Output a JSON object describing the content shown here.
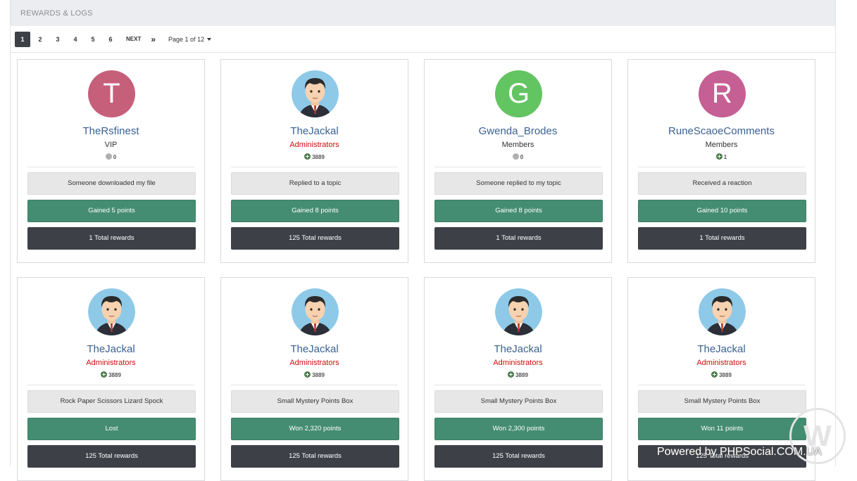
{
  "header": {
    "title": "REWARDS & LOGS"
  },
  "pagination": {
    "pages": [
      "1",
      "2",
      "3",
      "4",
      "5",
      "6"
    ],
    "active": "1",
    "next_label": "NEXT",
    "last_label": "»",
    "page_info": "Page 1 of 12"
  },
  "cards": [
    {
      "name": "TheRsfinest",
      "group": "VIP",
      "points": "0",
      "event": "Someone downloaded my file",
      "result": "Gained 5 points",
      "total": "1 Total rewards",
      "avatar_letter": "T",
      "avatar_color": "#c65f7a"
    },
    {
      "name": "TheJackal",
      "group": "Administrators",
      "points": "3889",
      "event": "Replied to a topic",
      "result": "Gained 8 points",
      "total": "125 Total rewards",
      "avatar_letter": ""
    },
    {
      "name": "Gwenda_Brodes",
      "group": "Members",
      "points": "0",
      "event": "Someone replied to my topic",
      "result": "Gained 8 points",
      "total": "1 Total rewards",
      "avatar_letter": "G",
      "avatar_color": "#63c462"
    },
    {
      "name": "RuneScaoeComments",
      "group": "Members",
      "points": "1",
      "event": "Received a reaction",
      "result": "Gained 10 points",
      "total": "1 Total rewards",
      "avatar_letter": "R",
      "avatar_color": "#c65f94"
    },
    {
      "name": "TheJackal",
      "group": "Administrators",
      "points": "3889",
      "event": "Rock Paper Scissors Lizard Spock",
      "result": "Lost",
      "total": "125 Total rewards",
      "avatar_letter": ""
    },
    {
      "name": "TheJackal",
      "group": "Administrators",
      "points": "3889",
      "event": "Small Mystery Points Box",
      "result": "Won 2,320 points",
      "total": "125 Total rewards",
      "avatar_letter": ""
    },
    {
      "name": "TheJackal",
      "group": "Administrators",
      "points": "3889",
      "event": "Small Mystery Points Box",
      "result": "Won 2,300 points",
      "total": "125 Total rewards",
      "avatar_letter": ""
    },
    {
      "name": "TheJackal",
      "group": "Administrators",
      "points": "3889",
      "event": "Small Mystery Points Box",
      "result": "Won 11 points",
      "total": "125 Total rewards",
      "avatar_letter": ""
    }
  ],
  "watermark": {
    "letter": "W",
    "powered_text": "Powered by PHPSocial.COM.UA"
  },
  "colors": {
    "admin_group": "#d00c0c",
    "result_bar": "#458d72",
    "total_bar": "#3d4047",
    "username": "#3b6193"
  }
}
